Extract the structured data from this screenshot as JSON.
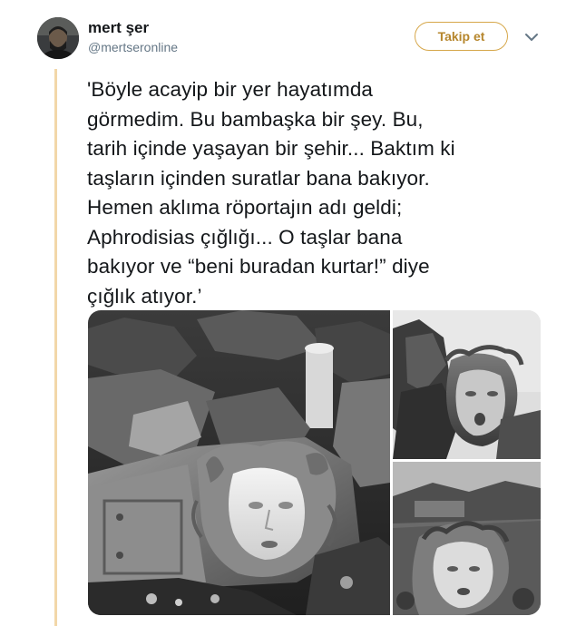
{
  "user": {
    "display_name": "mert şer",
    "handle": "@mertseronline"
  },
  "actions": {
    "follow_label": "Takip et"
  },
  "tweet": {
    "text": "'Böyle acayip bir yer hayatımda\ngörmedim. Bu bambaşka bir şey. Bu,\ntarih içinde yaşayan bir şehir... Baktım ki\ntaşların içinden suratlar bana bakıyor.\nHemen aklıma röportajın adı geldi;\nAphrodisias çığlığı... O taşlar bana\nbakıyor ve “beni buradan kurtar!” diye\nçığlık atıyor.’"
  },
  "media": {
    "count": 3
  },
  "colors": {
    "accent": "#d6a74a",
    "accent_text": "#b6862c",
    "rail": "#f2d7a9",
    "text": "#14171a",
    "muted": "#657786"
  },
  "icons": {
    "caret": "chevron-down-icon"
  }
}
